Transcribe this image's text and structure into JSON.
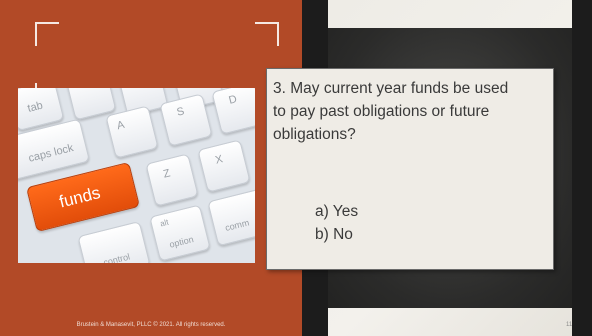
{
  "question": {
    "line1": "3. May current year funds be used",
    "line2": "to pay past obligations or future",
    "line3": "obligations?"
  },
  "options": {
    "a": "a) Yes",
    "b": "b) No"
  },
  "image": {
    "keys": {
      "tab": "tab",
      "caps": "caps lock",
      "funds": "funds",
      "a": "A",
      "s": "S",
      "d": "D",
      "z": "Z",
      "x": "X",
      "alt": "alt",
      "option": "option",
      "control": "control",
      "comm": "comm"
    }
  },
  "footer": {
    "copyright": "Brustein & Manasevit, PLLC © 2021. All rights reserved.",
    "page_number": "11"
  },
  "colors": {
    "accent": "#b24a27",
    "funds_key": "#ff6a1a"
  }
}
